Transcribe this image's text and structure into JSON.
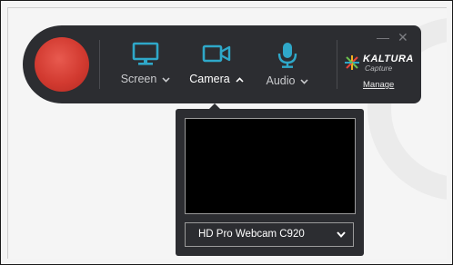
{
  "toolbar": {
    "screen_label": "Screen",
    "camera_label": "Camera",
    "audio_label": "Audio",
    "minimize": "—",
    "close": "✕"
  },
  "brand": {
    "name": "KALTURA",
    "product": "Capture",
    "manage_label": "Manage"
  },
  "camera_panel": {
    "selected_device": "HD Pro Webcam C920"
  },
  "colors": {
    "accent": "#2fa8c9",
    "record": "#d23a30",
    "toolbar_bg": "#2c2d31"
  },
  "icons": {
    "screen": "monitor-icon",
    "camera": "video-camera-icon",
    "audio": "microphone-icon"
  }
}
